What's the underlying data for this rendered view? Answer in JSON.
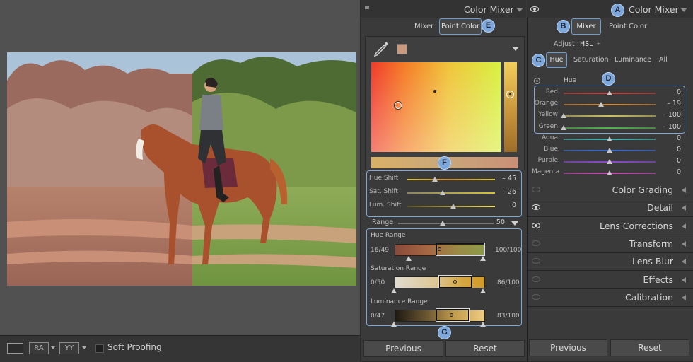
{
  "toolbar": {
    "soft_proofing_label": "Soft Proofing",
    "view_ra_label": "RA",
    "view_yy_label": "YY"
  },
  "middle_panel": {
    "title": "Color Mixer",
    "tabs": [
      {
        "label": "Mixer"
      },
      {
        "label": "Point Color",
        "selected": true
      }
    ],
    "sliders": [
      {
        "label": "Hue Shift",
        "value": "– 45"
      },
      {
        "label": "Sat. Shift",
        "value": "– 26"
      },
      {
        "label": "Lum. Shift",
        "value": "0"
      }
    ],
    "range": {
      "label": "Range",
      "value": "50"
    },
    "hue_range": {
      "label": "Hue Range",
      "left": "16/49",
      "right": "100/100"
    },
    "saturation_range": {
      "label": "Saturation Range",
      "left": "0/50",
      "right": "86/100"
    },
    "luminance_range": {
      "label": "Luminance Range",
      "left": "0/47",
      "right": "83/100"
    },
    "previous_label": "Previous",
    "reset_label": "Reset"
  },
  "right_panel": {
    "title": "Color Mixer",
    "tabs": [
      {
        "label": "Mixer",
        "selected": true
      },
      {
        "label": "Point Color"
      }
    ],
    "adjust_label": "Adjust :",
    "adjust_value": "HSL",
    "subtabs": [
      {
        "label": "Hue",
        "selected": true
      },
      {
        "label": "Saturation"
      },
      {
        "label": "Luminance"
      },
      {
        "label": "All"
      }
    ],
    "hue_header": "Hue",
    "hue_sliders": [
      {
        "label": "Red",
        "value": "0",
        "pos": 0.5,
        "color": "#c9423f"
      },
      {
        "label": "Orange",
        "value": "– 19",
        "pos": 0.41,
        "color": "#d98a3a"
      },
      {
        "label": "Yellow",
        "value": "– 100",
        "pos": 0.0,
        "color": "#d4c53a"
      },
      {
        "label": "Green",
        "value": "– 100",
        "pos": 0.0,
        "color": "#4db84a"
      },
      {
        "label": "Aqua",
        "value": "0",
        "pos": 0.5,
        "color": "#3fb6b6"
      },
      {
        "label": "Blue",
        "value": "0",
        "pos": 0.5,
        "color": "#3a6fd6"
      },
      {
        "label": "Purple",
        "value": "0",
        "pos": 0.5,
        "color": "#8a4ad0"
      },
      {
        "label": "Magenta",
        "value": "0",
        "pos": 0.5,
        "color": "#c64ab5"
      }
    ],
    "sections": [
      {
        "title": "Color Grading",
        "eye": false
      },
      {
        "title": "Detail",
        "eye": true
      },
      {
        "title": "Lens Corrections",
        "eye": true
      },
      {
        "title": "Transform",
        "eye": false
      },
      {
        "title": "Lens Blur",
        "eye": false
      },
      {
        "title": "Effects",
        "eye": false
      },
      {
        "title": "Calibration",
        "eye": false
      }
    ],
    "previous_label": "Previous",
    "reset_label": "Reset"
  },
  "callouts": {
    "a": "A",
    "b": "B",
    "c": "C",
    "d": "D",
    "e": "E",
    "f": "F",
    "g": "G"
  },
  "colors": {
    "accent_blue": "#7ea8dc",
    "sampled_swatch": "#c99a7e"
  }
}
